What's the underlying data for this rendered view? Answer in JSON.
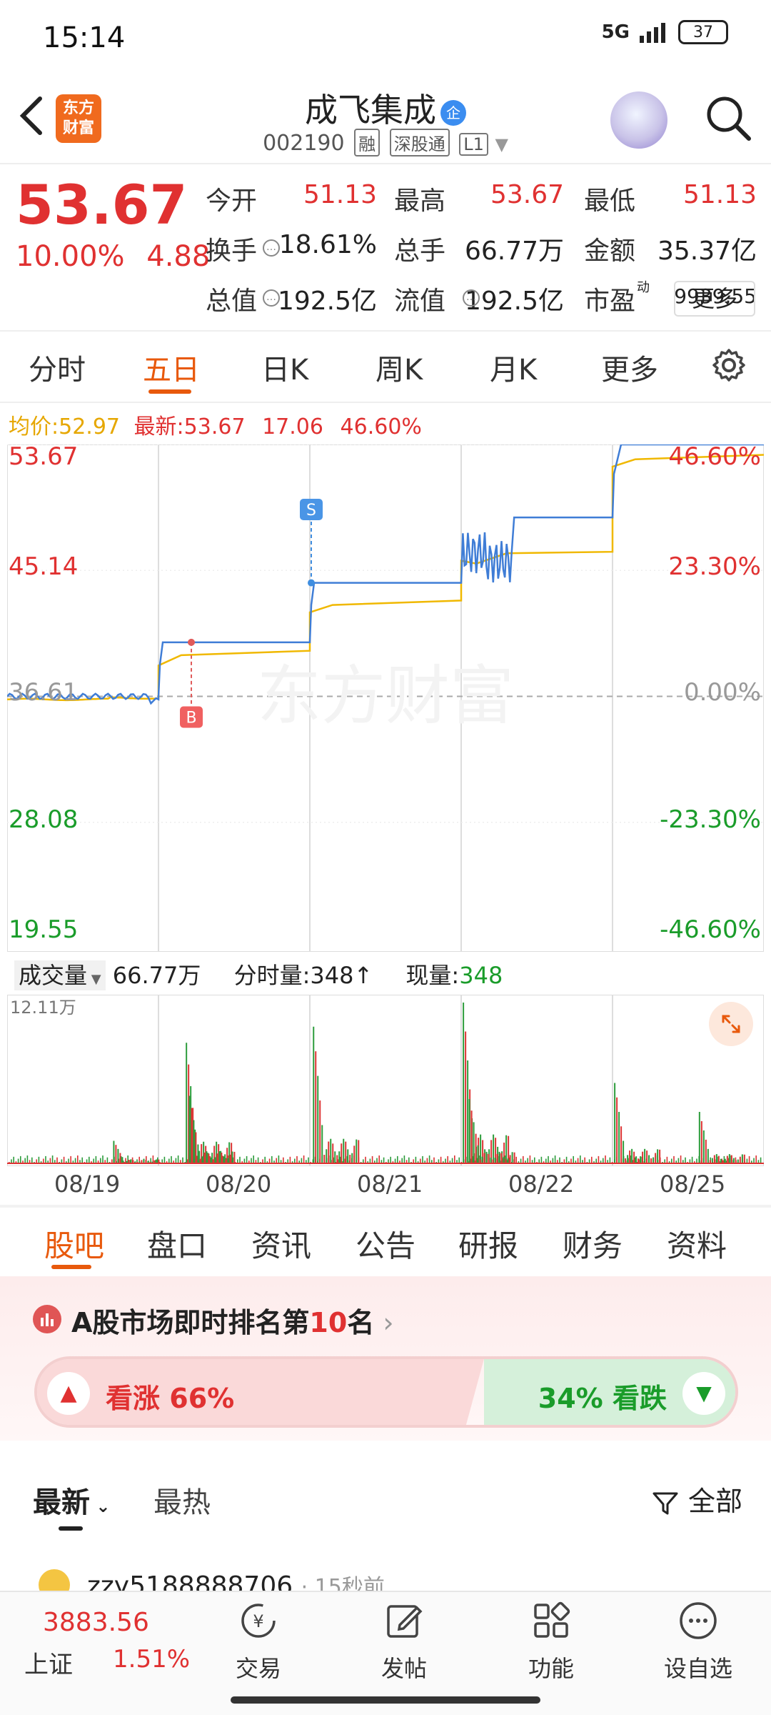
{
  "status_bar": {
    "time": "15:14",
    "network": "5G",
    "battery": "37"
  },
  "header": {
    "logo_text": "东方\n财富",
    "stock_name": "成飞集成",
    "badge": "企",
    "code": "002190",
    "tags": [
      "融",
      "深股通",
      "L1"
    ]
  },
  "quote": {
    "price": "53.67",
    "change_pct": "10.00%",
    "change_amt": "4.88",
    "rows": [
      [
        {
          "label": "今开",
          "value": "51.13",
          "color": "red"
        },
        {
          "label": "最高",
          "value": "53.67",
          "color": "red"
        },
        {
          "label": "最低",
          "value": "51.13",
          "color": "red"
        }
      ],
      [
        {
          "label": "换手",
          "value": "18.61%",
          "color": "dark"
        },
        {
          "label": "总手",
          "value": "66.77万",
          "color": "dark"
        },
        {
          "label": "金额",
          "value": "35.37亿",
          "color": "dark"
        }
      ],
      [
        {
          "label": "总值",
          "value": "192.5亿",
          "color": "dark"
        },
        {
          "label": "流值",
          "value": "192.5亿",
          "color": "dark"
        },
        {
          "label": "市盈",
          "sup": "动",
          "value": "9939.55",
          "color": "dark"
        }
      ]
    ],
    "more_label": "更多"
  },
  "period_tabs": [
    "分时",
    "五日",
    "日K",
    "周K",
    "月K",
    "更多"
  ],
  "active_period": "五日",
  "chart_info": {
    "avg_label": "均价:",
    "avg_value": "52.97",
    "latest_label": "最新:",
    "latest_value": "53.67",
    "change_amt": "17.06",
    "change_pct": "46.60%"
  },
  "chart_data": {
    "type": "line",
    "x": [
      "08/19",
      "08/20",
      "08/21",
      "08/22",
      "08/25"
    ],
    "series": [],
    "ylim": [
      19.55,
      53.67
    ],
    "y_ticks_left": [
      "53.67",
      "45.14",
      "36.61",
      "28.08",
      "19.55"
    ],
    "y_ticks_right": [
      "46.60%",
      "23.30%",
      "0.00%",
      "-23.30%",
      "-46.60%"
    ],
    "prev_close": 36.61,
    "day_close": [
      36.61,
      40.27,
      44.3,
      48.73,
      53.67
    ],
    "day_avg": [
      36.4,
      39.7,
      43.1,
      46.4,
      52.97
    ],
    "markers": [
      {
        "label": "B",
        "day": "08/20"
      },
      {
        "label": "S",
        "day": "08/21"
      }
    ],
    "watermark": "东方财富"
  },
  "volume": {
    "label": "成交量",
    "total": "66.77万",
    "minute_label": "分时量:",
    "minute_value": "348",
    "current_label": "现量:",
    "current_value": "348",
    "max_label": "12.11万",
    "spikes": [
      {
        "day": 0,
        "pos": 0.7,
        "v": 0.14
      },
      {
        "day": 1,
        "pos": 0.18,
        "v": 0.75
      },
      {
        "day": 1,
        "pos": 0.2,
        "v": 0.42
      },
      {
        "day": 2,
        "pos": 0.02,
        "v": 0.85
      },
      {
        "day": 3,
        "pos": 0.01,
        "v": 1.0
      },
      {
        "day": 3,
        "pos": 0.05,
        "v": 0.4
      },
      {
        "day": 4,
        "pos": 0.01,
        "v": 0.5
      },
      {
        "day": 4,
        "pos": 0.57,
        "v": 0.32
      }
    ]
  },
  "content_tabs": [
    "股吧",
    "盘口",
    "资讯",
    "公告",
    "研报",
    "财务",
    "资料"
  ],
  "active_content_tab": "股吧",
  "ranking": {
    "prefix": "A股市场即时排名第",
    "rank": "10",
    "suffix": "名"
  },
  "sentiment": {
    "bull_label": "看涨",
    "bull_pct": "66%",
    "bear_label": "看跌",
    "bear_pct": "34%"
  },
  "feed": {
    "tabs": [
      "最新",
      "最热"
    ],
    "filter_label": "全部",
    "post_user": "zzy5188888706",
    "post_time": "15秒前"
  },
  "bottom_bar": {
    "index_value": "3883.56",
    "index_name": "上证",
    "index_pct": "1.51%",
    "nav": [
      "交易",
      "发帖",
      "功能",
      "设自选"
    ]
  }
}
